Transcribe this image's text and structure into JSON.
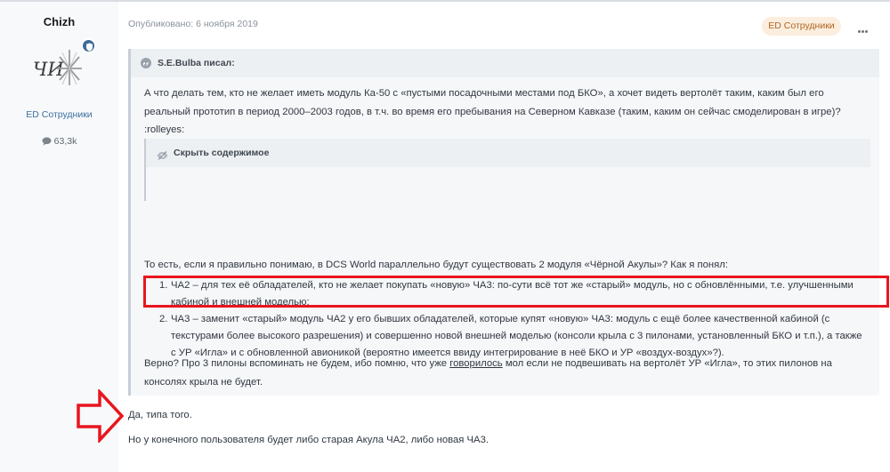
{
  "author": {
    "name": "Chizh",
    "group": "ED Сотрудники",
    "posts": "63,3k"
  },
  "post": {
    "date": "Опубликовано: 6 ноября 2019",
    "group_badge": "ED Сотрудники"
  },
  "quote": {
    "author": "S.E.Bulba писал:",
    "p1": "А что делать тем, кто не желает иметь модуль Ка-50 с «пустыми посадочными местами под БКО», а хочет видеть вертолёт таким, каким был его реальный прототип в период 2000–2003 годов, в т.ч. во время его пребывания на Северном Кавказе (таким, каким он сейчас смоделирован в игре)? :rolleyes:",
    "spoiler_label": "Скрыть содержимое",
    "p2": "То есть, если я правильно понимаю, в DCS World параллельно будут существовать 2 модуля «Чёрной Акулы»? Как я понял:",
    "list": [
      {
        "num": "1.",
        "text": "ЧА2 – для тех её обладателей, кто не желает покупать «новую» ЧА3: по-сути всё тот же «старый» модуль, но с обновлёнными, т.е. улучшенными кабиной и внешней моделью;"
      },
      {
        "num": "2.",
        "text": "ЧА3 – заменит «старый» модуль ЧА2 у его бывших обладателей, которые купят «новую» ЧА3: модуль с ещё более качественной кабиной (с текстурами более высокого разрешения) и совершенно новой внешней моделью (консоли крыла с 3 пилонами, установленный БКО и т.п.), а также с УР «Игла» и с обновленной авионикой (вероятно имеется ввиду интегрирование в неё БКО и УР «воздух-воздух»?)."
      }
    ],
    "p3_before": "Верно? Про 3 пилоны вспоминать не будем, ибо помню, что уже ",
    "p3_link": "говорилось",
    "p3_after": " мол если не подвешивать на вертолёт УР «Игла», то этих пилонов на консолях крыла не будет."
  },
  "body": {
    "p1": "Да, типа того.",
    "p2": "Но у конечного пользователя будет либо старая Акула ЧА2, либо новая ЧА3."
  },
  "icons": {
    "badge": "shield-badge-icon",
    "posts": "speech-bubble-icon",
    "quote": "quote-icon",
    "spoiler": "eye-slash-icon",
    "more": "ellipsis-icon"
  },
  "colors": {
    "accent": "#3f6f9f",
    "badge_bg": "#fbeede",
    "badge_text": "#b06323",
    "highlight_box": "#e8151e",
    "annotation_arrow": "#e8151e"
  }
}
